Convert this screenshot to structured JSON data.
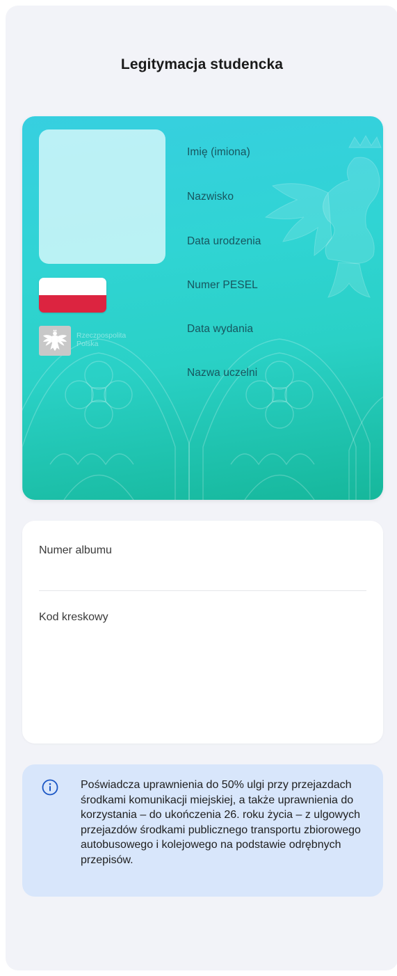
{
  "page": {
    "title": "Legitymacja studencka"
  },
  "card": {
    "emblem_caption_line1": "Rzeczpospolita",
    "emblem_caption_line2": "Polska",
    "fields": [
      {
        "label": "Imię (imiona)"
      },
      {
        "label": "Nazwisko"
      },
      {
        "label": "Data urodzenia"
      },
      {
        "label": "Numer PESEL"
      },
      {
        "label": "Data wydania"
      },
      {
        "label": "Nazwa uczelni"
      }
    ],
    "flag_colors": {
      "top": "#ffffff",
      "bottom": "#dc2440"
    },
    "gradient_colors": [
      "#37cfe0",
      "#2ad1c6",
      "#16b79b"
    ]
  },
  "details": {
    "album_number_label": "Numer albumu",
    "barcode_label": "Kod kreskowy"
  },
  "info": {
    "icon": "info-icon",
    "text": "Poświadcza uprawnienia do 50% ulgi przy przejazdach środkami komunikacji miejskiej, a także uprawnienia do korzystania – do ukończenia 26. roku życia – z ulgowych przejazdów środkami publicznego transportu zbiorowego autobusowego i kolejowego na podstawie odrębnych przepisów.",
    "accent_color": "#1a56c4",
    "background_color": "#d8e6fb"
  }
}
